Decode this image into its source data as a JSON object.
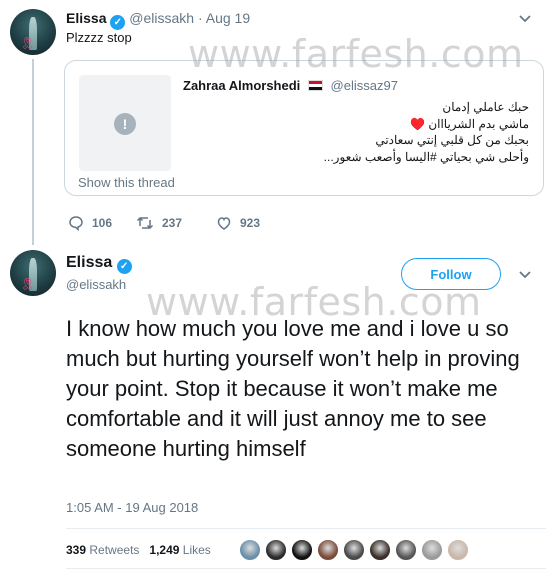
{
  "first_tweet": {
    "display_name": "Elissa",
    "handle": "@elissakh",
    "separator": "·",
    "date": "Aug 19",
    "text": "Plzzzz stop"
  },
  "quoted_tweet": {
    "display_name": "Zahraa Almorshedi",
    "handle": "@elissaz97",
    "text_lines": [
      "حبك عاملي إدمان",
      "ماشي بدم الشريااان ♥️",
      "بحبك من كل قلبي إنتي سعادتي",
      "وأحلى شي بحياتي #اليسا وأصعب شعور..."
    ],
    "show_thread": "Show this thread"
  },
  "actions": {
    "replies": "106",
    "retweets": "237",
    "likes": "923"
  },
  "main_tweet": {
    "display_name": "Elissa",
    "handle": "@elissakh",
    "follow_label": "Follow",
    "text": "I know how much you love me and i love u so much but hurting yourself won’t help in proving your point. Stop it because it won’t make me comfortable and it will just annoy me to see someone hurting himself",
    "timestamp": "1:05 AM - 19 Aug 2018",
    "retweets_count": "339",
    "retweets_label": "Retweets",
    "likes_count": "1,249",
    "likes_label": "Likes"
  },
  "watermark": "www.farfesh.com",
  "colors": {
    "accent": "#1da1f2",
    "muted": "#657786",
    "heart": "#e0245e"
  },
  "liker_avatar_colors": [
    "#6b8fa8",
    "#2b2b2b",
    "#111111",
    "#7a4b3a",
    "#4a4a4a",
    "#3a2f2a",
    "#555555",
    "#9a9a9a",
    "#c9b8a8"
  ]
}
